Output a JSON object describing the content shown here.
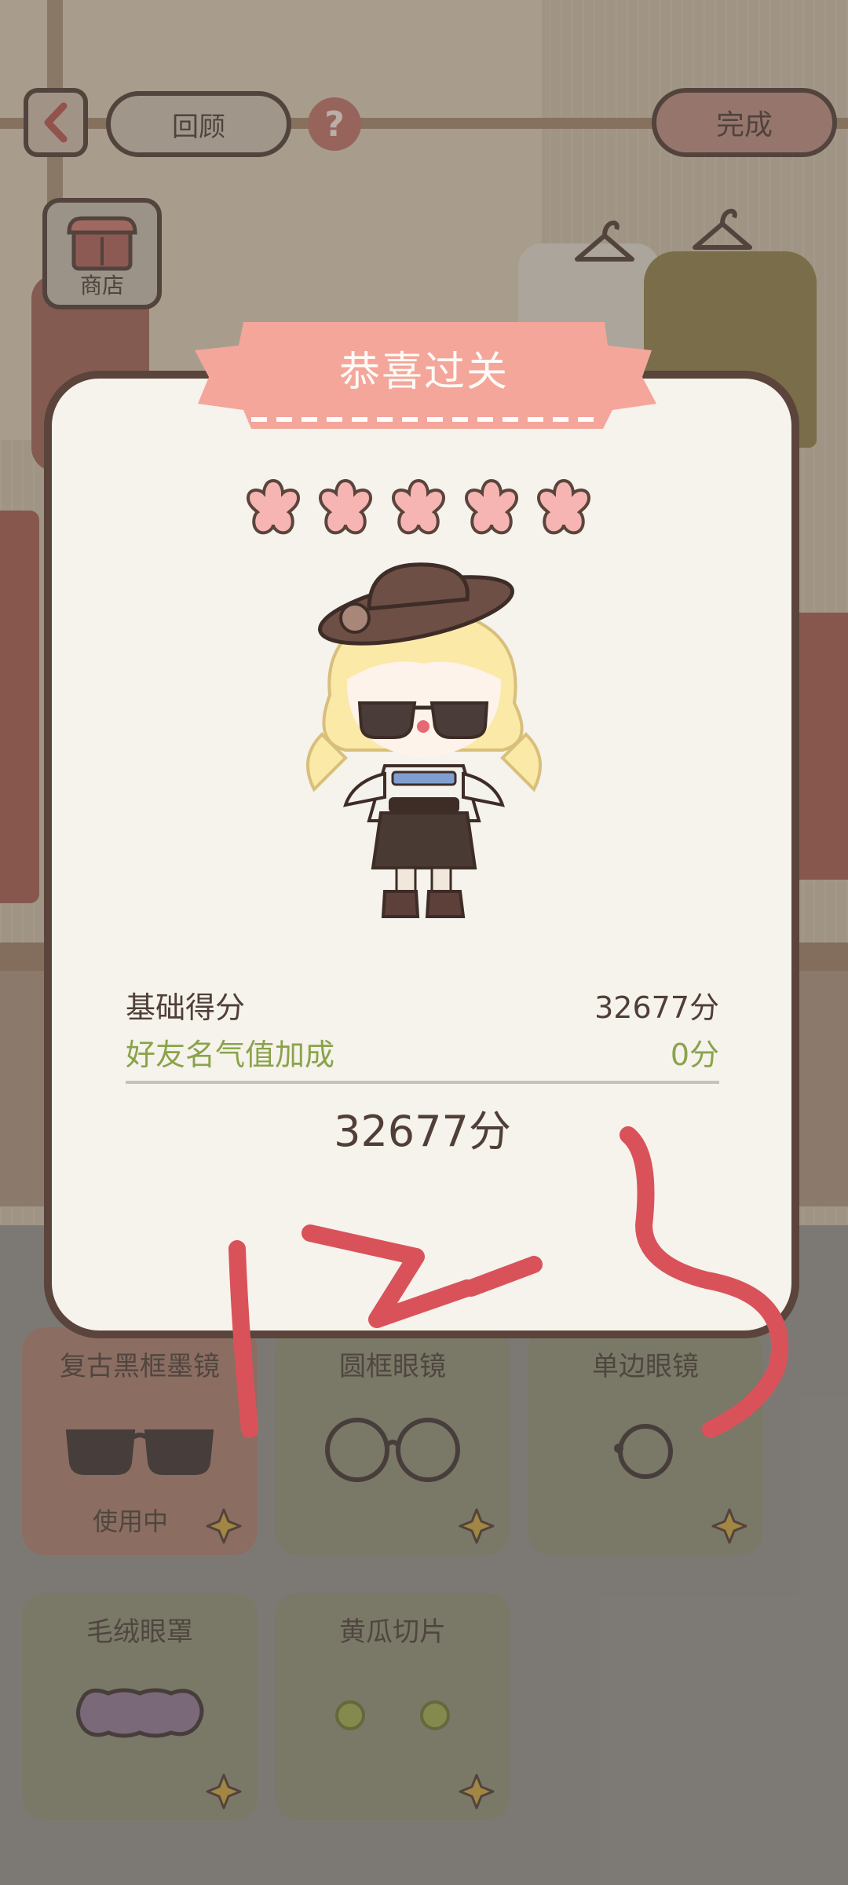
{
  "top_bar": {
    "back_icon": "chevron-left-icon",
    "review_label": "回顾",
    "help_label": "?",
    "done_label": "完成",
    "shop_label": "商店"
  },
  "dialog": {
    "title": "恭喜过关",
    "stars": 5,
    "base_score_label": "基础得分",
    "base_score_value": "32677分",
    "bonus_label": "好友名气值加成",
    "bonus_value": "0分",
    "total_score": "32677分"
  },
  "items": [
    {
      "name": "复古黑框墨镜",
      "status": "使用中"
    },
    {
      "name": "圆框眼镜",
      "status": ""
    },
    {
      "name": "单边眼镜",
      "status": ""
    },
    {
      "name": "毛绒眼罩",
      "status": ""
    },
    {
      "name": "黄瓜切片",
      "status": ""
    }
  ],
  "handwriting": "12-5",
  "colors": {
    "banner": "#f4a69b",
    "star": "#f6b5b2",
    "bonus_text": "#8aa34a",
    "scribble": "#d9525a"
  }
}
